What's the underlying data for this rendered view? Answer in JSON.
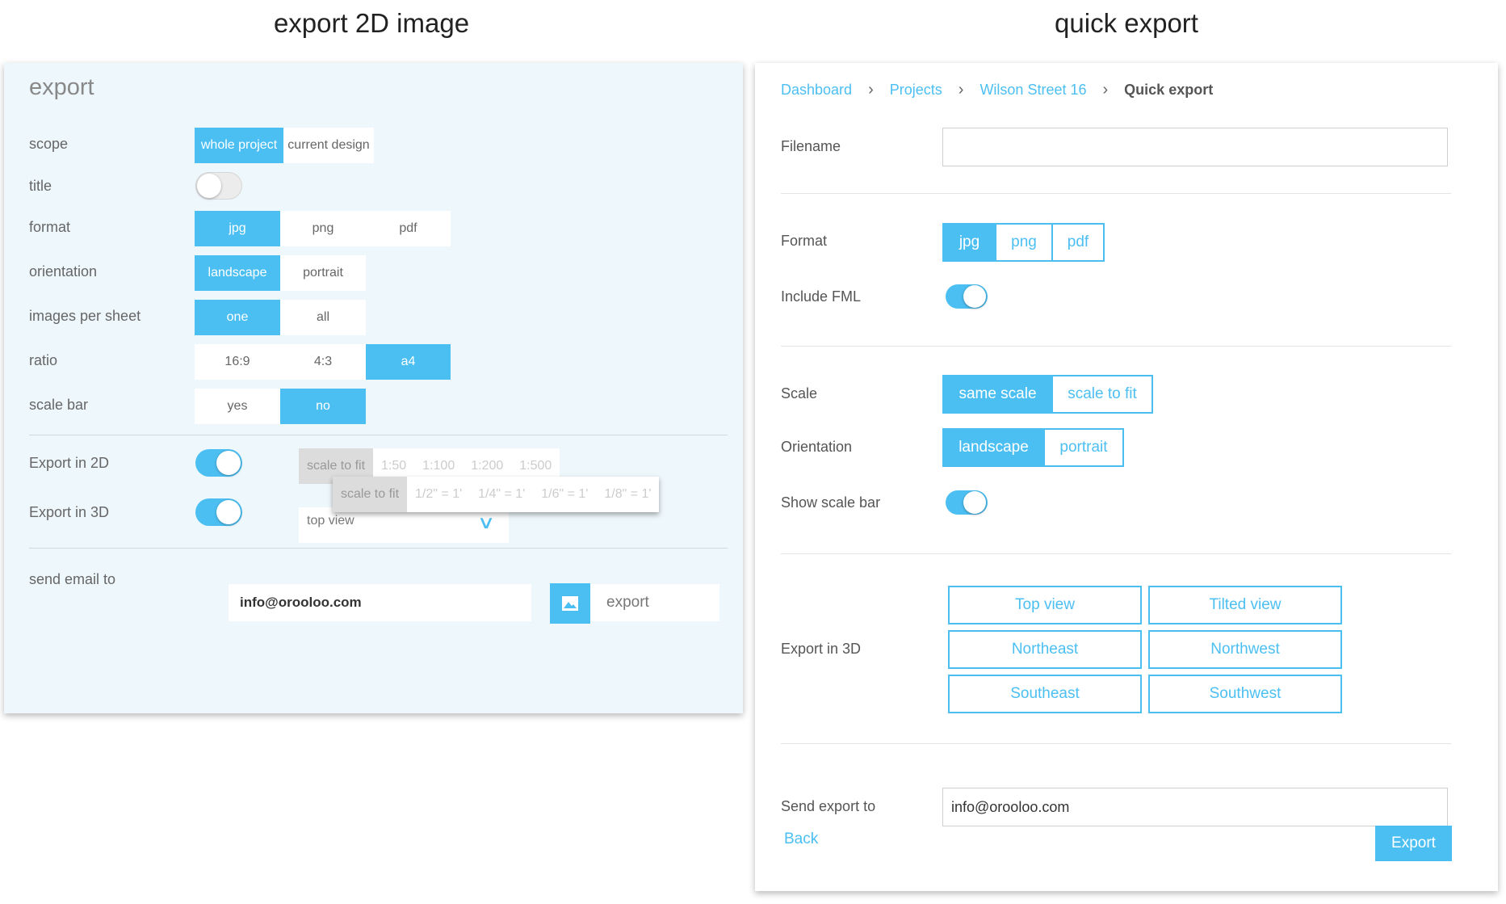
{
  "headings": {
    "left": "export 2D image",
    "right": "quick export"
  },
  "left": {
    "title": "export",
    "scope": {
      "label": "scope",
      "options": [
        "whole project",
        "current design"
      ],
      "selected": "whole project"
    },
    "title_toggle": {
      "label": "title",
      "on": false
    },
    "format": {
      "label": "format",
      "options": [
        "jpg",
        "png",
        "pdf"
      ],
      "selected": "jpg"
    },
    "orientation": {
      "label": "orientation",
      "options": [
        "landscape",
        "portrait"
      ],
      "selected": "landscape"
    },
    "images_per_sheet": {
      "label": "images per sheet",
      "options": [
        "one",
        "all"
      ],
      "selected": "one"
    },
    "ratio": {
      "label": "ratio",
      "options": [
        "16:9",
        "4:3",
        "a4"
      ],
      "selected": "a4"
    },
    "scale_bar": {
      "label": "scale bar",
      "options": [
        "yes",
        "no"
      ],
      "selected": "no"
    },
    "export_2d": {
      "label": "Export in 2D",
      "on": true,
      "scales": [
        "scale to fit",
        "1:50",
        "1:100",
        "1:200",
        "1:500"
      ],
      "imperial_scales": [
        "scale to fit",
        "1/2\" = 1'",
        "1/4\" = 1'",
        "1/6\" = 1'",
        "1/8\" = 1'"
      ]
    },
    "export_3d": {
      "label": "Export in 3D",
      "on": true,
      "view": "top view"
    },
    "send_email": {
      "label": "send email to",
      "value": "info@orooloo.com"
    },
    "export_button": "export"
  },
  "right": {
    "breadcrumb": [
      "Dashboard",
      "Projects",
      "Wilson Street 16",
      "Quick export"
    ],
    "filename": {
      "label": "Filename",
      "value": ""
    },
    "format": {
      "label": "Format",
      "options": [
        "jpg",
        "png",
        "pdf"
      ],
      "selected": "jpg"
    },
    "include_fml": {
      "label": "Include FML",
      "on": true
    },
    "scale": {
      "label": "Scale",
      "options": [
        "same scale",
        "scale to fit"
      ],
      "selected": "same scale"
    },
    "orientation": {
      "label": "Orientation",
      "options": [
        "landscape",
        "portrait"
      ],
      "selected": "landscape"
    },
    "show_scale_bar": {
      "label": "Show scale bar",
      "on": true
    },
    "export_3d": {
      "label": "Export in 3D",
      "views": [
        "Top view",
        "Tilted view",
        "Northeast",
        "Northwest",
        "Southeast",
        "Southwest"
      ]
    },
    "send_export": {
      "label": "Send export to",
      "value": "info@orooloo.com"
    },
    "back": "Back",
    "export": "Export"
  },
  "colors": {
    "accent": "#4cbff2",
    "panel_bg": "#eef7fc"
  }
}
